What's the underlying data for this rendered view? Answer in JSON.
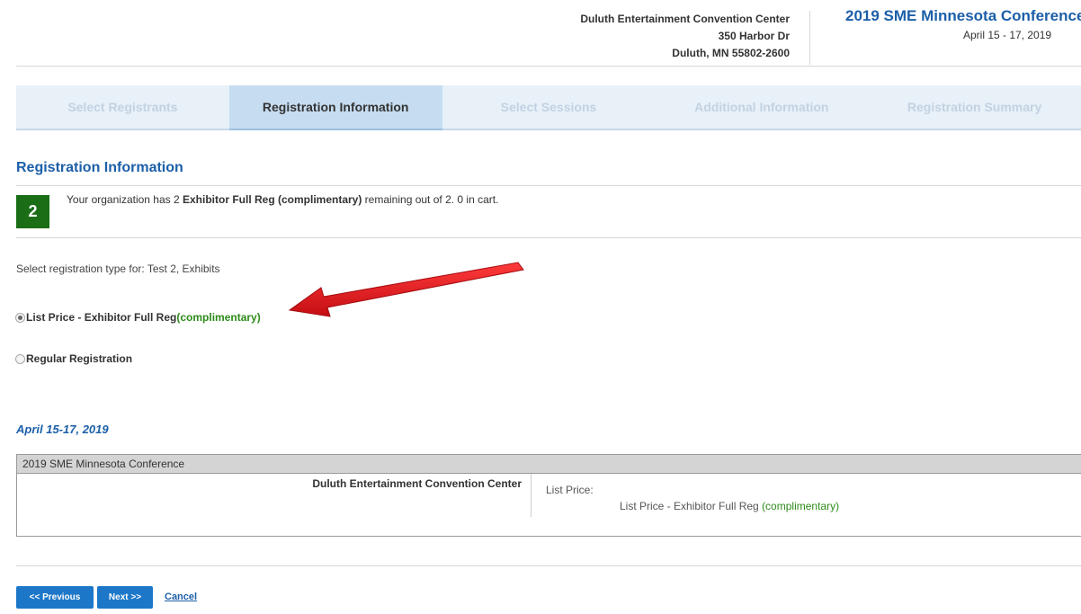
{
  "header": {
    "venue": {
      "name": "Duluth Entertainment Convention Center",
      "address": "350 Harbor Dr",
      "city": "Duluth, MN 55802-2600"
    },
    "conference_title": "2019 SME Minnesota Conference",
    "conference_dates": "April 15 - 17, 2019"
  },
  "steps": [
    {
      "label": "Select Registrants",
      "active": false
    },
    {
      "label": "Registration Information",
      "active": true
    },
    {
      "label": "Select Sessions",
      "active": false
    },
    {
      "label": "Additional Information",
      "active": false
    },
    {
      "label": "Registration Summary",
      "active": false
    }
  ],
  "section": {
    "title": "Registration Information",
    "badge_count": "2",
    "notice_prefix": "Your organization has 2 ",
    "notice_bold": "Exhibitor Full Reg (complimentary)",
    "notice_suffix": " remaining out of 2. 0 in cart."
  },
  "registration": {
    "select_prompt": "Select registration type for: Test 2, Exhibits",
    "options": [
      {
        "label": "List Price - Exhibitor Full Reg ",
        "tag": "(complimentary)",
        "selected": true
      },
      {
        "label": "Regular Registration",
        "tag": "",
        "selected": false
      }
    ]
  },
  "event": {
    "date_heading": "April 15-17, 2019",
    "table_header": "2019 SME Minnesota Conference",
    "venue": "Duluth Entertainment Convention Center",
    "price_label": "List Price:",
    "price_value_prefix": "List Price - Exhibitor Full Reg ",
    "price_value_tag": "(complimentary)"
  },
  "buttons": {
    "previous": "<< Previous",
    "next": "Next >>",
    "cancel": "Cancel"
  },
  "colors": {
    "accent": "#1c5fa8",
    "button": "#1d77c9",
    "badge": "#1b6e16",
    "complimentary": "#2e8b1a",
    "annotation_arrow": "#e8141b"
  }
}
